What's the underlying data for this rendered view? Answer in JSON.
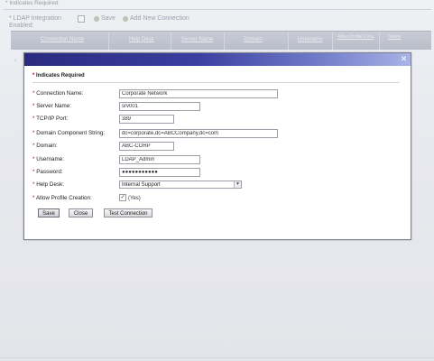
{
  "background": {
    "required_note": "* Indicates Required",
    "ldap_label_line1": "* LDAP Integration",
    "ldap_label_line2": "Enabled:",
    "actions": {
      "save": "Save",
      "add_new": "Add New Connection"
    },
    "table_headers": [
      "Connection Name",
      "Help Desk",
      "Server Name",
      "Domain",
      "Username",
      "Allow Profile Crea",
      "Delete"
    ],
    "row_marker": "*"
  },
  "modal": {
    "required_note": "Indicates Required",
    "fields": {
      "connection_name": {
        "label": "Connection Name:",
        "value": "Corporate Network"
      },
      "server_name": {
        "label": "Server Name:",
        "value": "srv001"
      },
      "tcpip_port": {
        "label": "TCP/IP Port:",
        "value": "389"
      },
      "domain_component": {
        "label": "Domain Component String:",
        "value": "dc=corporate,dc=ABCCompany,dc=com"
      },
      "domain": {
        "label": "Domain:",
        "value": "ABC-CORP"
      },
      "username": {
        "label": "Username:",
        "value": "LDAP_Admin"
      },
      "password": {
        "label": "Password:",
        "value": "●●●●●●●●●●●"
      },
      "help_desk": {
        "label": "Help Desk:",
        "value": "Internal Support"
      },
      "allow_profile": {
        "label": "Allow Profile Creation:",
        "value": "(Yes)",
        "checked": true
      }
    },
    "buttons": {
      "save": "Save",
      "close": "Close",
      "test": "Test Connection"
    },
    "close_glyph": "✕"
  },
  "colors": {
    "header_start": "#2a2a80",
    "header_end": "#a8b3e6",
    "required_star": "#cc0000"
  }
}
